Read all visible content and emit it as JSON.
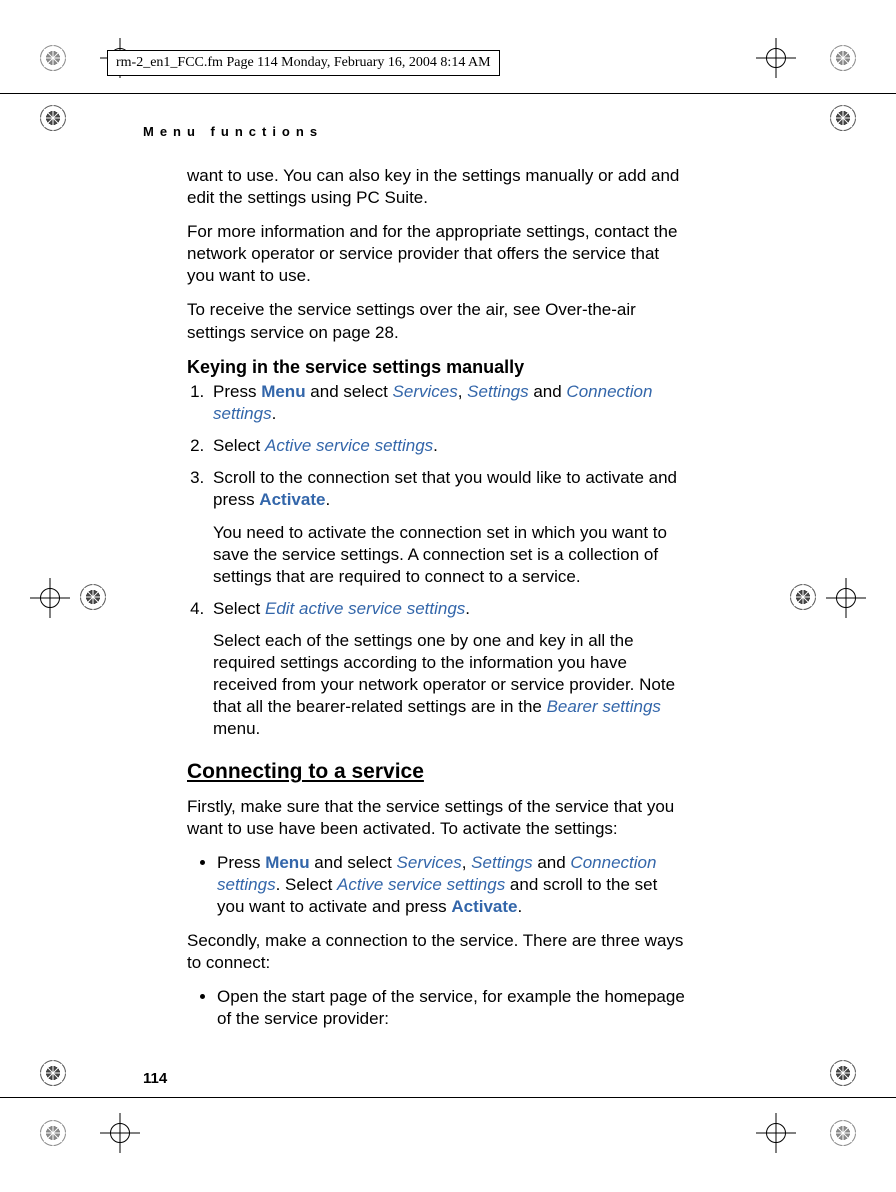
{
  "header_line": "rm-2_en1_FCC.fm  Page 114  Monday, February 16, 2004  8:14 AM",
  "section_header": "Menu functions",
  "page_number": "114",
  "intro": {
    "p1": "want to use. You can also key in the settings manually or add and edit the settings using PC Suite.",
    "p2": "For more information and for the appropriate settings, contact the network operator or service provider that offers the service that you want to use.",
    "p3": "To receive the service settings over the air, see Over-the-air settings service on page 28."
  },
  "sub1_title": "Keying in the service settings manually",
  "steps": {
    "s1_a": "Press ",
    "s1_menu": "Menu",
    "s1_b": " and select ",
    "s1_services": "Services",
    "s1_c": ", ",
    "s1_settings": "Settings",
    "s1_d": " and ",
    "s1_conn": "Connection settings",
    "s1_e": ".",
    "s2_a": "Select ",
    "s2_active": "Active service settings",
    "s2_b": ".",
    "s3_a": "Scroll to the connection set that you would like to activate and press ",
    "s3_act": "Activate",
    "s3_b": ".",
    "s3_sub": "You need to activate the connection set in which you want to save the service settings. A connection set is a collection of settings that are required to connect to a service.",
    "s4_a": "Select ",
    "s4_edit": "Edit active service settings",
    "s4_b": ".",
    "s4_sub_a": "Select each of the settings one by one and key in all the required settings according to the information you have received from your network operator or service provider. Note that all the bearer-related settings are in the ",
    "s4_bearer": "Bearer settings",
    "s4_sub_b": " menu."
  },
  "h2": "Connecting to a service",
  "conn": {
    "p1": "Firstly, make sure that the service settings of the service that you want to use have been activated. To activate the settings:",
    "b1_a": "Press ",
    "b1_menu": "Menu",
    "b1_b": " and select ",
    "b1_services": "Services",
    "b1_c": ", ",
    "b1_settings": "Settings",
    "b1_d": " and ",
    "b1_conn": "Connection settings",
    "b1_e": ". Select ",
    "b1_active": "Active service settings",
    "b1_f": " and scroll to the set you want to activate and press ",
    "b1_act": "Activate",
    "b1_g": ".",
    "p2": "Secondly, make a connection to the service. There are three ways to connect:",
    "b2": "Open the start page of the service, for example the homepage of the service provider:"
  }
}
